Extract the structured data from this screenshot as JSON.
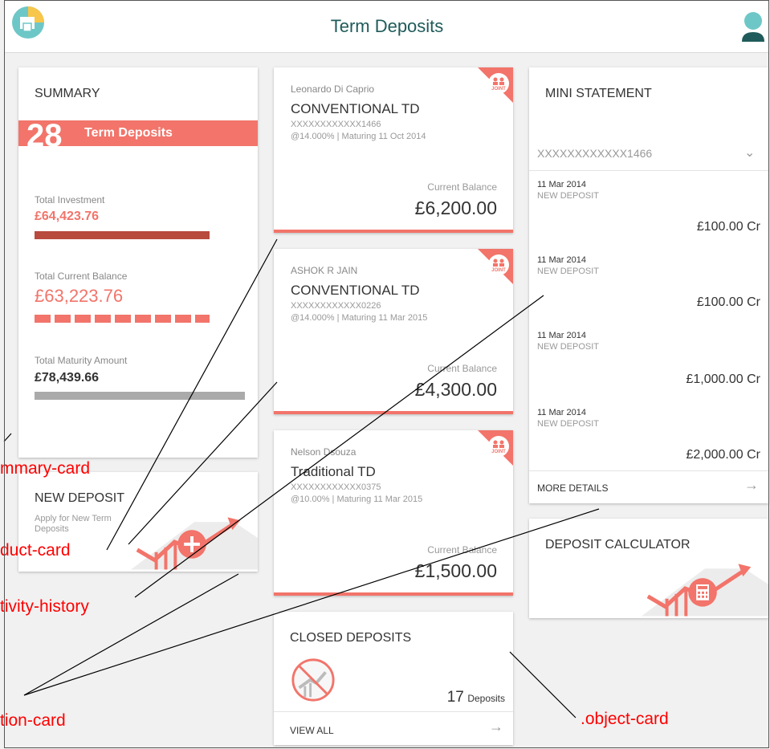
{
  "header": {
    "title": "Term Deposits"
  },
  "summary": {
    "title": "SUMMARY",
    "count": "28",
    "count_label": "Term Deposits",
    "metrics": [
      {
        "label": "Total Investment",
        "value": "£64,423.76",
        "color": "#f2746a"
      },
      {
        "label": "Total Current Balance",
        "value": "£63,223.76",
        "color": "#f2746a"
      },
      {
        "label": "Total Maturity Amount",
        "value": "£78,439.66",
        "color": "#333333"
      }
    ]
  },
  "new_deposit": {
    "title": "NEW DEPOSIT",
    "subtitle": "Apply for New Term Deposits"
  },
  "products": [
    {
      "holder": "Leonardo Di Caprio",
      "type": "CONVENTIONAL TD",
      "account": "XXXXXXXXXXXX1466",
      "rate": "@14.000% | Maturing 11 Oct 2014",
      "balance_label": "Current Balance",
      "balance": "£6,200.00",
      "badge": "JOINT"
    },
    {
      "holder": "ASHOK R JAIN",
      "type": "CONVENTIONAL TD",
      "account": "XXXXXXXXXXXX0226",
      "rate": "@14.000% | Maturing 11 Mar 2015",
      "balance_label": "Current Balance",
      "balance": "£4,300.00",
      "badge": "JOINT"
    },
    {
      "holder": "Nelson Dsouza",
      "type": "Traditional TD",
      "account": "XXXXXXXXXXXX0375",
      "rate": "@10.00% | Maturing 11 Mar 2015",
      "balance_label": "Current Balance",
      "balance": "£1,500.00",
      "badge": "JOINT"
    }
  ],
  "closed_deposits": {
    "title": "CLOSED DEPOSITS",
    "count": "17",
    "count_label": "Deposits",
    "link": "VIEW ALL"
  },
  "mini_statement": {
    "title": "MINI STATEMENT",
    "account": "XXXXXXXXXXXX1466",
    "transactions": [
      {
        "date": "11 Mar 2014",
        "type": "NEW DEPOSIT",
        "amount": "£100.00 Cr"
      },
      {
        "date": "11 Mar 2014",
        "type": "NEW DEPOSIT",
        "amount": "£100.00 Cr"
      },
      {
        "date": "11 Mar 2014",
        "type": "NEW DEPOSIT",
        "amount": "£1,000.00 Cr"
      },
      {
        "date": "11 Mar 2014",
        "type": "NEW DEPOSIT",
        "amount": "£2,000.00 Cr"
      }
    ],
    "link": "MORE DETAILS"
  },
  "deposit_calculator": {
    "title": "DEPOSIT CALCULATOR"
  },
  "annotations": {
    "summary_card": "mmary-card",
    "product_card": "duct-card",
    "activity_history": "tivity-history",
    "action_card": "tion-card",
    "object_card": ".object-card"
  },
  "colors": {
    "accent": "#f2746a",
    "header_title": "#1f5b5a",
    "summary_bar_dark": "#b84a3e",
    "annotation": "#ff0000"
  }
}
